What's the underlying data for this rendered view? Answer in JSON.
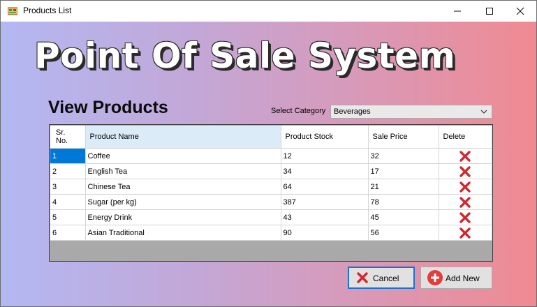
{
  "window": {
    "title": "Products List"
  },
  "banner": {
    "title": "Point Of Sale System"
  },
  "page": {
    "heading": "View Products"
  },
  "category": {
    "label": "Select Category",
    "selected": "Beverages"
  },
  "grid": {
    "columns": [
      "Sr.\nNo.",
      "Product Name",
      "Product Stock",
      "Sale Price",
      "Delete"
    ],
    "rows": [
      [
        "1",
        "Coffee",
        "12",
        "32"
      ],
      [
        "2",
        "English Tea",
        "34",
        "17"
      ],
      [
        "3",
        "Chinese Tea",
        "64",
        "21"
      ],
      [
        "4",
        "Sugar (per kg)",
        "387",
        "78"
      ],
      [
        "5",
        "Energy Drink",
        "43",
        "45"
      ],
      [
        "6",
        "Asian Traditional",
        "90",
        "56"
      ]
    ],
    "selected_row": 0,
    "delete_icon": "red-x-icon"
  },
  "buttons": {
    "cancel": "Cancel",
    "add_new": "Add New"
  },
  "colors": {
    "selection": "#0078d7",
    "delete": "#d0282f",
    "add": "#e43b3b",
    "cancel_border": "#1e73c8"
  }
}
